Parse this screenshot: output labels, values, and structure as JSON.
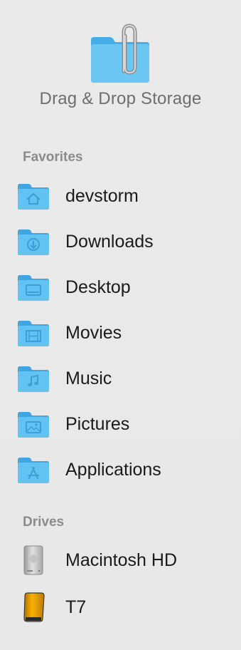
{
  "app": {
    "title": "Drag & Drop Storage",
    "icon": "paperclip-folder-icon"
  },
  "favorites": {
    "header": "Favorites",
    "items": [
      {
        "label": "devstorm",
        "icon": "home-folder-icon"
      },
      {
        "label": "Downloads",
        "icon": "downloads-folder-icon"
      },
      {
        "label": "Desktop",
        "icon": "desktop-folder-icon"
      },
      {
        "label": "Movies",
        "icon": "movies-folder-icon"
      },
      {
        "label": "Music",
        "icon": "music-folder-icon"
      },
      {
        "label": "Pictures",
        "icon": "pictures-folder-icon"
      },
      {
        "label": "Applications",
        "icon": "applications-folder-icon"
      }
    ]
  },
  "drives": {
    "header": "Drives",
    "items": [
      {
        "label": "Macintosh HD",
        "icon": "internal-drive-icon"
      },
      {
        "label": "T7",
        "icon": "external-drive-icon"
      }
    ]
  },
  "colors": {
    "folder_front": "#5fc1f3",
    "folder_back": "#45aee6",
    "section_header": "#8b8b8b",
    "title": "#6e6e6e",
    "drive_orange": "#f2a500"
  }
}
